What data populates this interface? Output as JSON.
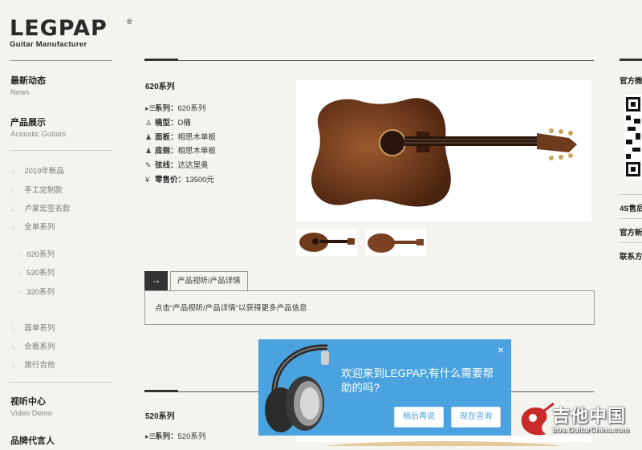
{
  "logo": {
    "wordmark": "LEGPAP",
    "reg": "®",
    "tagline": "Guitar Manufacturer"
  },
  "sidebar": {
    "news": {
      "title": "最新动态",
      "subtitle": "News"
    },
    "products": {
      "title": "产品展示",
      "subtitle": "Acoustic Guitars"
    },
    "items": [
      "2019年新品",
      "手工定制款",
      "卢家宏签名款",
      "全单系列"
    ],
    "subitems": [
      "620系列",
      "520系列",
      "320系列"
    ],
    "items2": [
      "面单系列",
      "合板系列",
      "旅行吉他"
    ],
    "video": {
      "title": "视听中心",
      "subtitle": "Video Demo"
    },
    "endorser": {
      "title": "品牌代言人"
    }
  },
  "product": {
    "title": "620系列",
    "specs": [
      {
        "icon": "list-icon",
        "label": "系列：",
        "value": "620系列"
      },
      {
        "icon": "guitar-body-icon",
        "label": "桶型：",
        "value": "D桶"
      },
      {
        "icon": "guitar-icon",
        "label": "面板：",
        "value": "相思木单板"
      },
      {
        "icon": "guitar-icon",
        "label": "底侧：",
        "value": "相思木单板"
      },
      {
        "icon": "strings-icon",
        "label": "弦线：",
        "value": "达达里奥"
      },
      {
        "icon": "yen-icon",
        "label": "零售价：",
        "value": "13500元"
      }
    ]
  },
  "tabs": {
    "arrow": "→",
    "label": "产品视听/产品详情",
    "content": "点击“产品视听/产品详情”以获得更多产品信息"
  },
  "product2": {
    "title": "520系列",
    "spec1_label": "系列：",
    "spec1_value": "520系列"
  },
  "right": {
    "official_wechat": "官方微",
    "store": "4S售后",
    "official_news": "官方新",
    "contact": "联系方"
  },
  "chat": {
    "close": "×",
    "message": "欢迎来到LEGPAP,有什么需要帮助的吗?",
    "later": "稍后再说",
    "now": "现在咨询",
    "color": "#4aa3df"
  },
  "watermark": {
    "name": "吉他中国",
    "url": "bbs.GuitarChina.com"
  }
}
